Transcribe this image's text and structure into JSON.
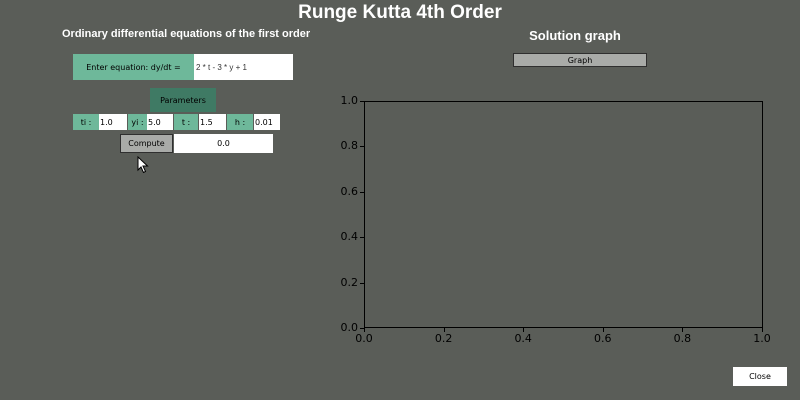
{
  "window": {
    "title": "Runge Kutta 4th Order"
  },
  "left_panel": {
    "heading": "Ordinary differential equations of the first order",
    "equation_label": "Enter equation: dy/dt =",
    "equation_value": "2 * t - 3 * y + 1",
    "parameters_label": "Parameters",
    "params": [
      {
        "label": "ti :",
        "value": "1.0"
      },
      {
        "label": "yi :",
        "value": "5.0"
      },
      {
        "label": "t :",
        "value": "1.5"
      },
      {
        "label": "h :",
        "value": "0.01"
      }
    ],
    "compute_label": "Compute",
    "result_value": "0.0"
  },
  "right_panel": {
    "heading": "Solution graph",
    "graph_button_label": "Graph"
  },
  "close_label": "Close",
  "colors": {
    "background": "#5a5d58",
    "accent": "#6eb89a",
    "accent_dark": "#3f7a64",
    "button_gray": "#a9aba8"
  },
  "chart_data": {
    "type": "line",
    "title": "",
    "xlabel": "",
    "ylabel": "",
    "xlim": [
      0.0,
      1.0
    ],
    "ylim": [
      0.0,
      1.0
    ],
    "x_ticks": [
      "0.0",
      "0.2",
      "0.4",
      "0.6",
      "0.8",
      "1.0"
    ],
    "y_ticks": [
      "0.0",
      "0.2",
      "0.4",
      "0.6",
      "0.8",
      "1.0"
    ],
    "series": []
  }
}
